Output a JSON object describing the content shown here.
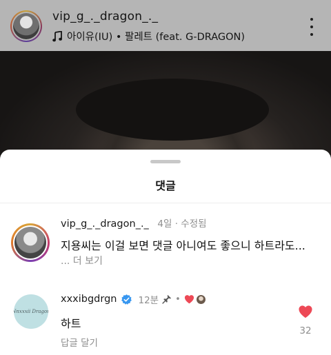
{
  "header": {
    "username": "vip_g_._dragon_._",
    "music": "아이유(IU) • 팔레트 (feat. G-DRAGON)"
  },
  "comments_sheet": {
    "title": "댓글",
    "caption": {
      "username": "vip_g_._dragon_._",
      "meta": "4일 · 수정됨",
      "text": "지용씨는 이걸 보면 댓글 아니여도 좋으니 하트라도...",
      "more_label": "... 더 보기"
    },
    "comment": {
      "username": "xxxibgdrgn",
      "time": "12분",
      "separator": "•",
      "avatar_text": "Nnxxxii Dragon",
      "text": "하트",
      "reply_label": "답글 달기",
      "like_count": "32",
      "like_color": "#ed4956",
      "verified_color": "#3897f0"
    }
  }
}
